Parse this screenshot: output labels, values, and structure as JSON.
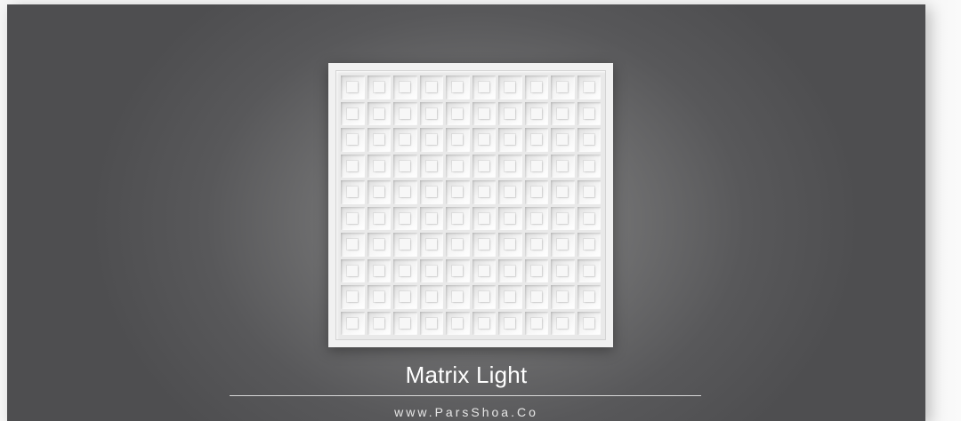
{
  "banner": {
    "product_name": "Matrix Light",
    "website": "www.ParsShoa.Co"
  },
  "panel": {
    "rows": 10,
    "columns": 10
  },
  "colors": {
    "background": "#5a5a5c",
    "panel": "#f1f1f1",
    "text": "#ffffff"
  }
}
